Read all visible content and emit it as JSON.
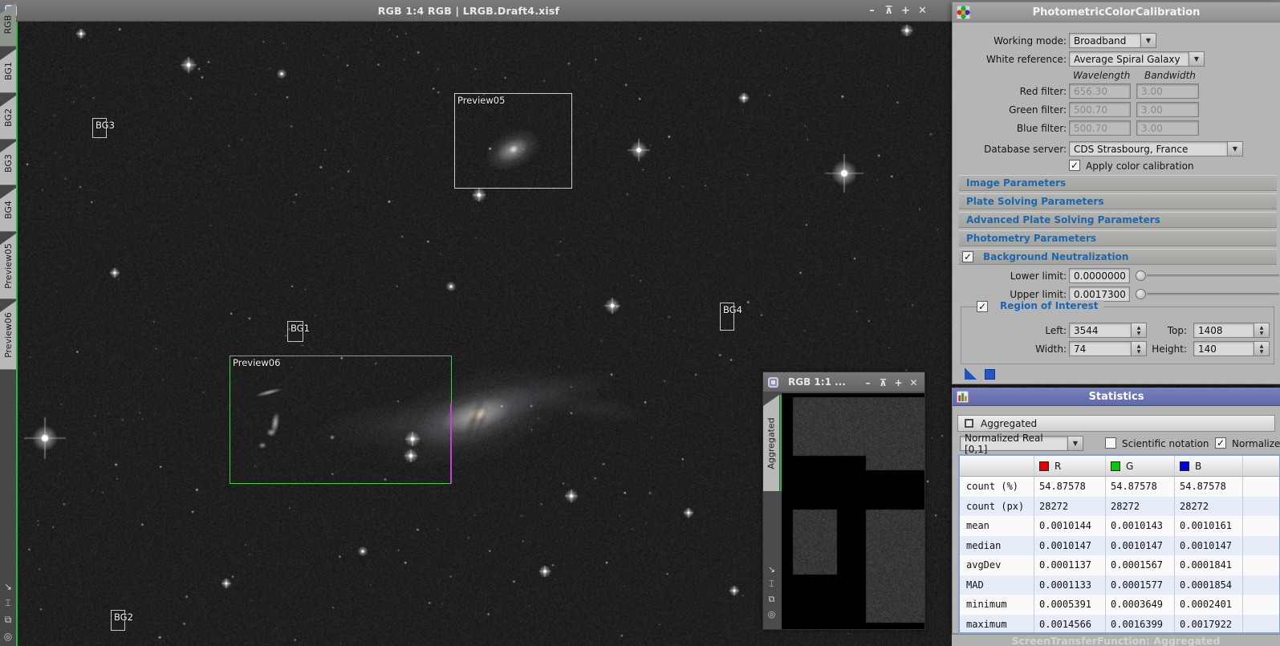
{
  "main_window": {
    "title": "RGB 1:4 RGB | LRGB.Draft4.xisf",
    "tabs": [
      "RGB",
      "BG1",
      "BG2",
      "BG3",
      "BG4",
      "Preview05",
      "Preview06"
    ]
  },
  "previews": {
    "p05": "Preview05",
    "p06": "Preview06",
    "bg1": "BG1",
    "bg2": "BG2",
    "bg3": "BG3",
    "bg4": "BG4"
  },
  "preview_window": {
    "title": "RGB 1:1 ...",
    "tab": "Aggregated"
  },
  "pcc": {
    "title": "PhotometricColorCalibration",
    "working_mode_label": "Working mode:",
    "working_mode_value": "Broadband",
    "white_reference_label": "White reference:",
    "white_reference_value": "Average Spiral Galaxy",
    "wavelength_header": "Wavelength",
    "bandwidth_header": "Bandwidth",
    "red_filter_label": "Red filter:",
    "red_wavelength": "656.30",
    "red_bandwidth": "3.00",
    "green_filter_label": "Green filter:",
    "green_wavelength": "500.70",
    "green_bandwidth": "3.00",
    "blue_filter_label": "Blue filter:",
    "blue_wavelength": "500.70",
    "blue_bandwidth": "3.00",
    "database_server_label": "Database server:",
    "database_server_value": "CDS Strasbourg, France",
    "apply_label": "Apply color calibration",
    "sections": [
      "Image Parameters",
      "Plate Solving Parameters",
      "Advanced Plate Solving Parameters",
      "Photometry Parameters"
    ],
    "bn_title": "Background Neutralization",
    "lower_limit_label": "Lower limit:",
    "lower_limit_value": "0.0000000",
    "upper_limit_label": "Upper limit:",
    "upper_limit_value": "0.0017300",
    "roi_title": "Region of Interest",
    "left_label": "Left:",
    "left_value": "3544",
    "top_label": "Top:",
    "top_value": "1408",
    "width_label": "Width:",
    "width_value": "74",
    "height_label": "Height:",
    "height_value": "140"
  },
  "statistics": {
    "title": "Statistics",
    "aggregated_label": "Aggregated",
    "range_value": "Normalized Real [0,1]",
    "scientific_label": "Scientific notation",
    "normalized_label": "Normalized",
    "columns": {
      "r": "R",
      "g": "G",
      "b": "B"
    },
    "rows": [
      {
        "label": "count (%)",
        "r": "54.87578",
        "g": "54.87578",
        "b": "54.87578"
      },
      {
        "label": "count (px)",
        "r": "28272",
        "g": "28272",
        "b": "28272"
      },
      {
        "label": "mean",
        "r": "0.0010144",
        "g": "0.0010143",
        "b": "0.0010161"
      },
      {
        "label": "median",
        "r": "0.0010147",
        "g": "0.0010147",
        "b": "0.0010147"
      },
      {
        "label": "avgDev",
        "r": "0.0001137",
        "g": "0.0001567",
        "b": "0.0001841"
      },
      {
        "label": "MAD",
        "r": "0.0001133",
        "g": "0.0001577",
        "b": "0.0001854"
      },
      {
        "label": "minimum",
        "r": "0.0005391",
        "g": "0.0003649",
        "b": "0.0002401"
      },
      {
        "label": "maximum",
        "r": "0.0014566",
        "g": "0.0016399",
        "b": "0.0017922"
      }
    ]
  },
  "ghost_window": {
    "title": "ScreenTransferFunction: Aggregated"
  },
  "colors": {
    "r_swatch": "#e20000",
    "g_swatch": "#00cc00",
    "b_swatch": "#0000e2",
    "accent_blue": "#1c67ae",
    "green_edge": "#23bd3a"
  },
  "icons": {
    "minimize": "–",
    "shade": "⊼",
    "plus": "+",
    "close": "✕",
    "dropdown": "▼",
    "check": "✓",
    "up": "▲",
    "down": "▼",
    "resize": "↘",
    "fit": "⌶",
    "clone": "⧉",
    "target": "◎"
  }
}
